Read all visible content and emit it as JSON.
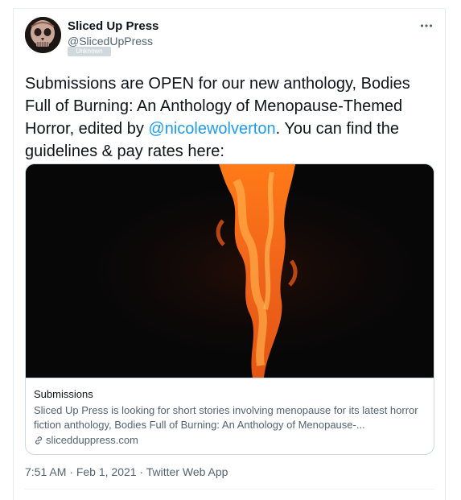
{
  "author": {
    "display_name": "Sliced Up Press",
    "handle": "@SlicedUpPress",
    "badge": "Unknown"
  },
  "more_icon": "more-horizontal-icon",
  "tweet": {
    "text_before": "Submissions are OPEN for our new anthology, Bodies Full of Burning: An Anthology of Menopause-Themed Horror, edited by ",
    "mention": "@nicolewolverton",
    "text_after": ". You can find the guidelines & pay rates here:"
  },
  "card": {
    "title": "Submissions",
    "description": "Sliced Up Press is looking for short stories involving menopause for its latest horror fiction anthology, Bodies Full of Burning: An Anthology of Menopause-...",
    "domain": "slicedduppress.com",
    "domain_icon": "link-icon"
  },
  "meta": {
    "time": "7:51 AM",
    "separator": "·",
    "date": "Feb 1, 2021",
    "source": "Twitter Web App"
  },
  "colors": {
    "mention": "#1d9bf0",
    "secondary_text": "#536471",
    "border": "#cfd9de",
    "badge_bg": "#cfd9de"
  }
}
